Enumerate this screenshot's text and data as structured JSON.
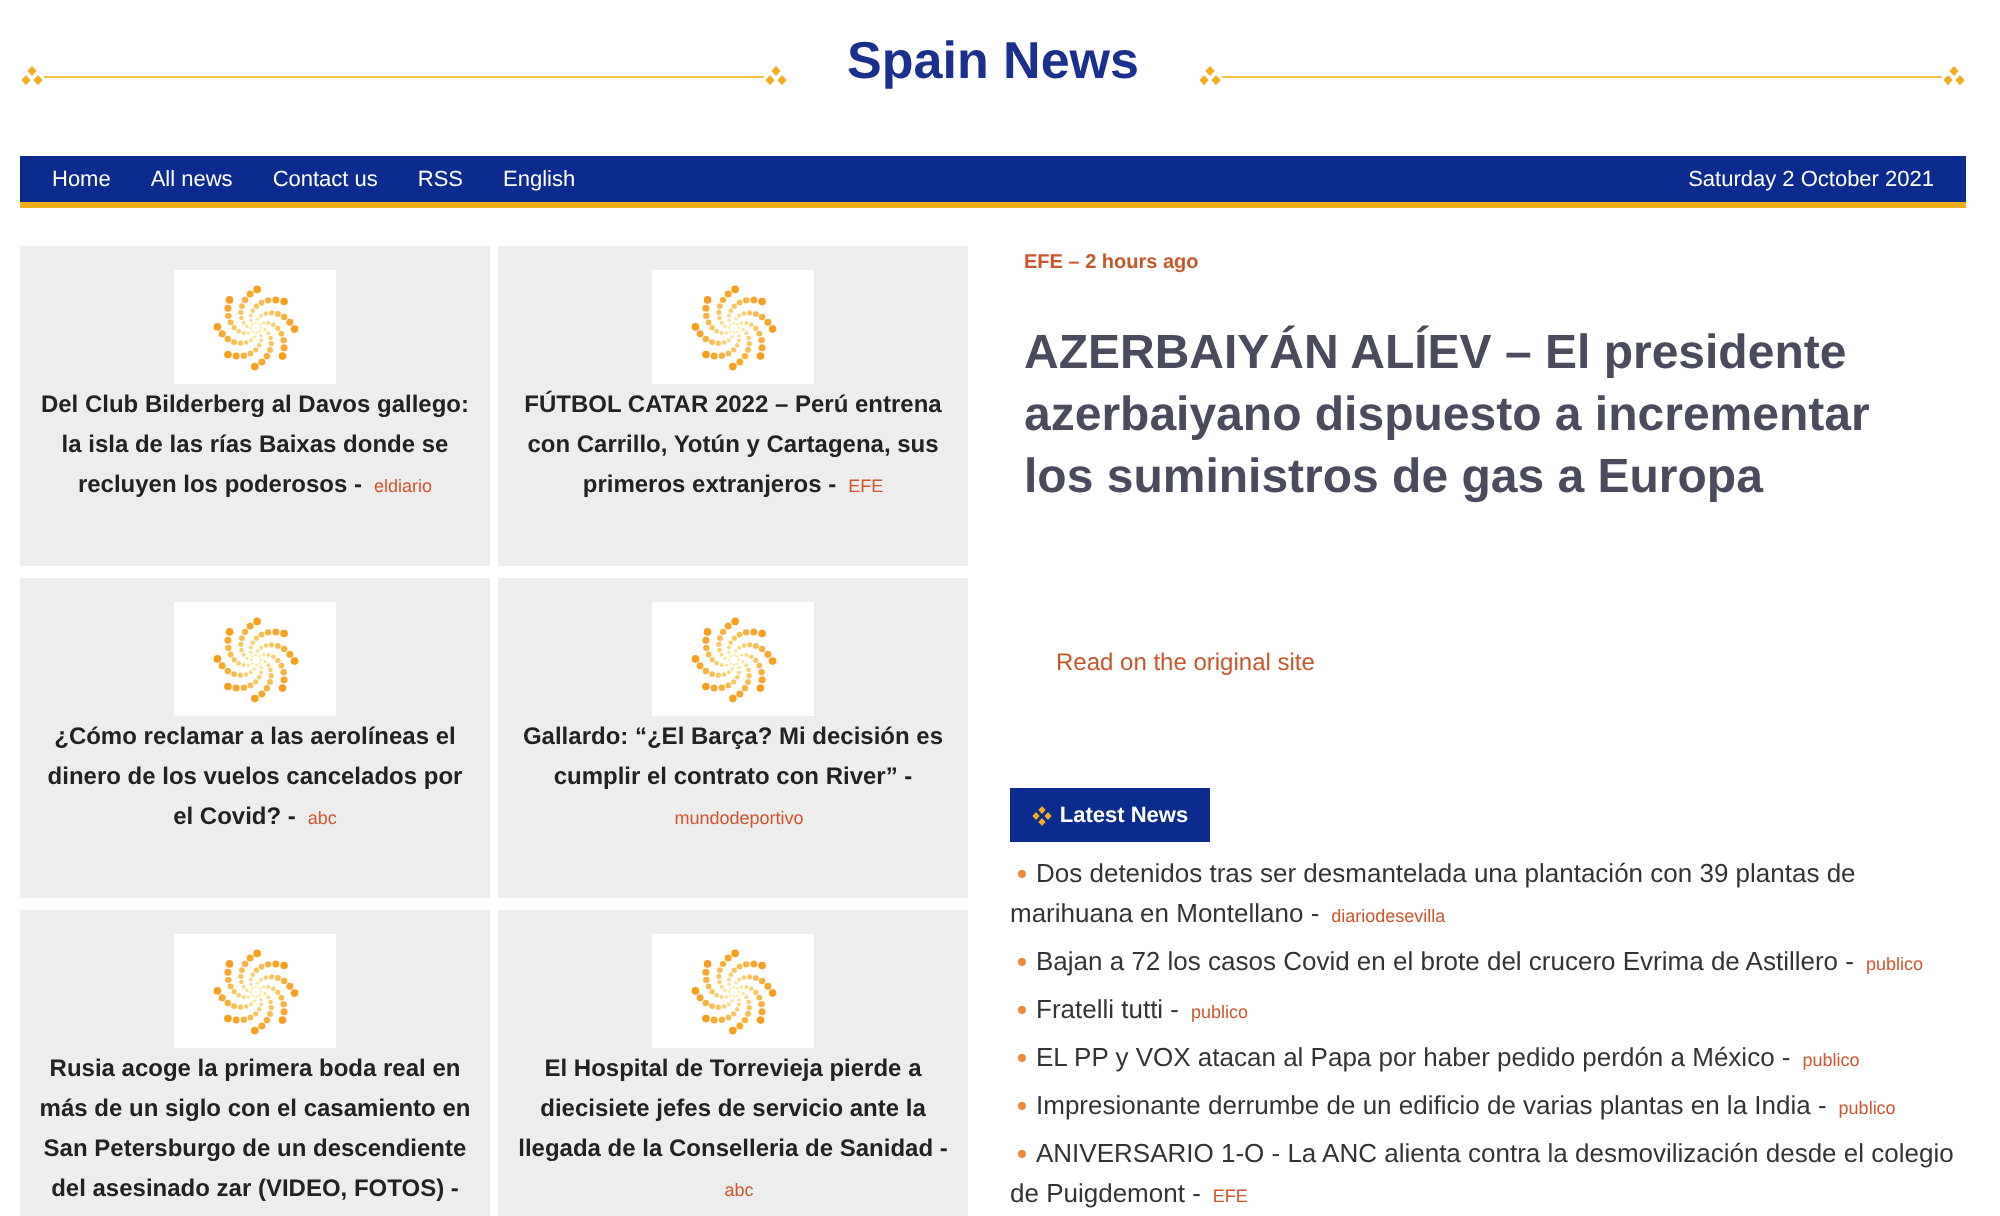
{
  "header": {
    "title": "Spain News"
  },
  "nav": {
    "links": [
      "Home",
      "All news",
      "Contact us",
      "RSS",
      "English"
    ],
    "date": "Saturday 2 October 2021"
  },
  "cards": [
    {
      "title": "Del Club Bilderberg al Davos gallego: la isla de las rías Baixas donde se recluyen los poderosos -",
      "source": "eldiario"
    },
    {
      "title": "FÚTBOL CATAR 2022 – Perú entrena con Carrillo, Yotún y Cartagena, sus primeros extranjeros -",
      "source": "EFE"
    },
    {
      "title": "¿Cómo reclamar a las aerolíneas el dinero de los vuelos cancelados por el Covid? -",
      "source": "abc"
    },
    {
      "title": "Gallardo: “¿El Barça? Mi decisión es cumplir el contrato con River” -",
      "source": "mundodeportivo"
    },
    {
      "title": "Rusia acoge la primera boda real en más de un siglo con el casamiento en San Petersburgo de un descendiente del asesinado zar (VIDEO, FOTOS) -"
    },
    {
      "title": "El Hospital de Torrevieja pierde a diecisiete jefes de servicio ante la llegada de la Conselleria de Sanidad -",
      "source": "abc"
    }
  ],
  "featured": {
    "meta": "EFE – 2 hours ago",
    "headline": "AZERBAIYÁN ALÍEV – El presidente azerbaiyano dispuesto a incrementar los suministros de gas a Europa",
    "link": "Read on the original site"
  },
  "latest": {
    "heading": "Latest News",
    "items": [
      {
        "title": "Dos detenidos tras ser desmantelada una plantación con 39 plantas de marihuana en Montellano -",
        "source": "diariodesevilla"
      },
      {
        "title": "Bajan a 72 los casos Covid en el brote del crucero Evrima de Astillero -",
        "source": "publico"
      },
      {
        "title": "Fratelli tutti -",
        "source": "publico"
      },
      {
        "title": "EL PP y VOX atacan al Papa por haber pedido perdón a México -",
        "source": "publico"
      },
      {
        "title": "Impresionante derrumbe de un edificio de varias plantas en la India -",
        "source": "publico"
      },
      {
        "title": "ANIVERSARIO 1-O - La ANC alienta contra la desmovilización desde el colegio de Puigdemont -",
        "source": "EFE"
      }
    ]
  }
}
